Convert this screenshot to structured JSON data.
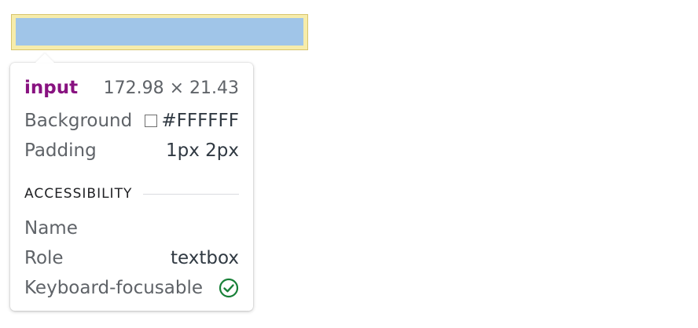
{
  "element": {
    "tag": "input",
    "dimensions": "172.98 × 21.43"
  },
  "styles": {
    "background_label": "Background",
    "background_value": "#FFFFFF",
    "background_swatch_color": "#FFFFFF",
    "padding_label": "Padding",
    "padding_value": "1px 2px"
  },
  "accessibility": {
    "section_title": "ACCESSIBILITY",
    "name_label": "Name",
    "name_value": "",
    "role_label": "Role",
    "role_value": "textbox",
    "focusable_label": "Keyboard-focusable",
    "focusable_icon": "check-circle-icon",
    "focusable_color": "#188038"
  },
  "colors": {
    "tag_color": "#881280",
    "highlight_content": "#a0c5e8",
    "highlight_padding": "#f6ecab"
  }
}
